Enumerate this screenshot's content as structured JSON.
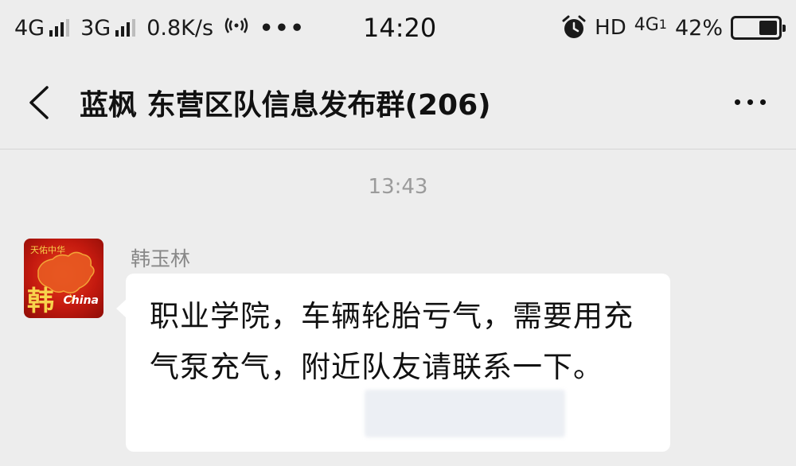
{
  "status_bar": {
    "net1": "4G",
    "net2": "3G",
    "speed": "0.8K/s",
    "more": "•••",
    "time": "14:20",
    "hd": "HD",
    "net3": "4G",
    "net3_sub": "1",
    "battery": "42%",
    "battery_level": 0.42,
    "icons": [
      "signal-icon",
      "hotspot-icon",
      "alarm-icon",
      "battery-icon"
    ]
  },
  "header": {
    "title": "蓝枫 东营区队信息发布群(206)",
    "back_icon": "chevron-left-icon",
    "more_icon": "more-dots-icon"
  },
  "messages": [
    {
      "time": "13:43",
      "sender": "韩玉林",
      "avatar_text": "韩",
      "avatar_caption": "China",
      "avatar_tag": "天佑中华",
      "text": "职业学院，车辆轮胎亏气，需要用充气泵充气，附近队友请联系一下。"
    }
  ],
  "colors": {
    "background": "#ededed",
    "bubble": "#ffffff",
    "avatar_red": "#c41a0f",
    "muted_text": "#888888"
  }
}
